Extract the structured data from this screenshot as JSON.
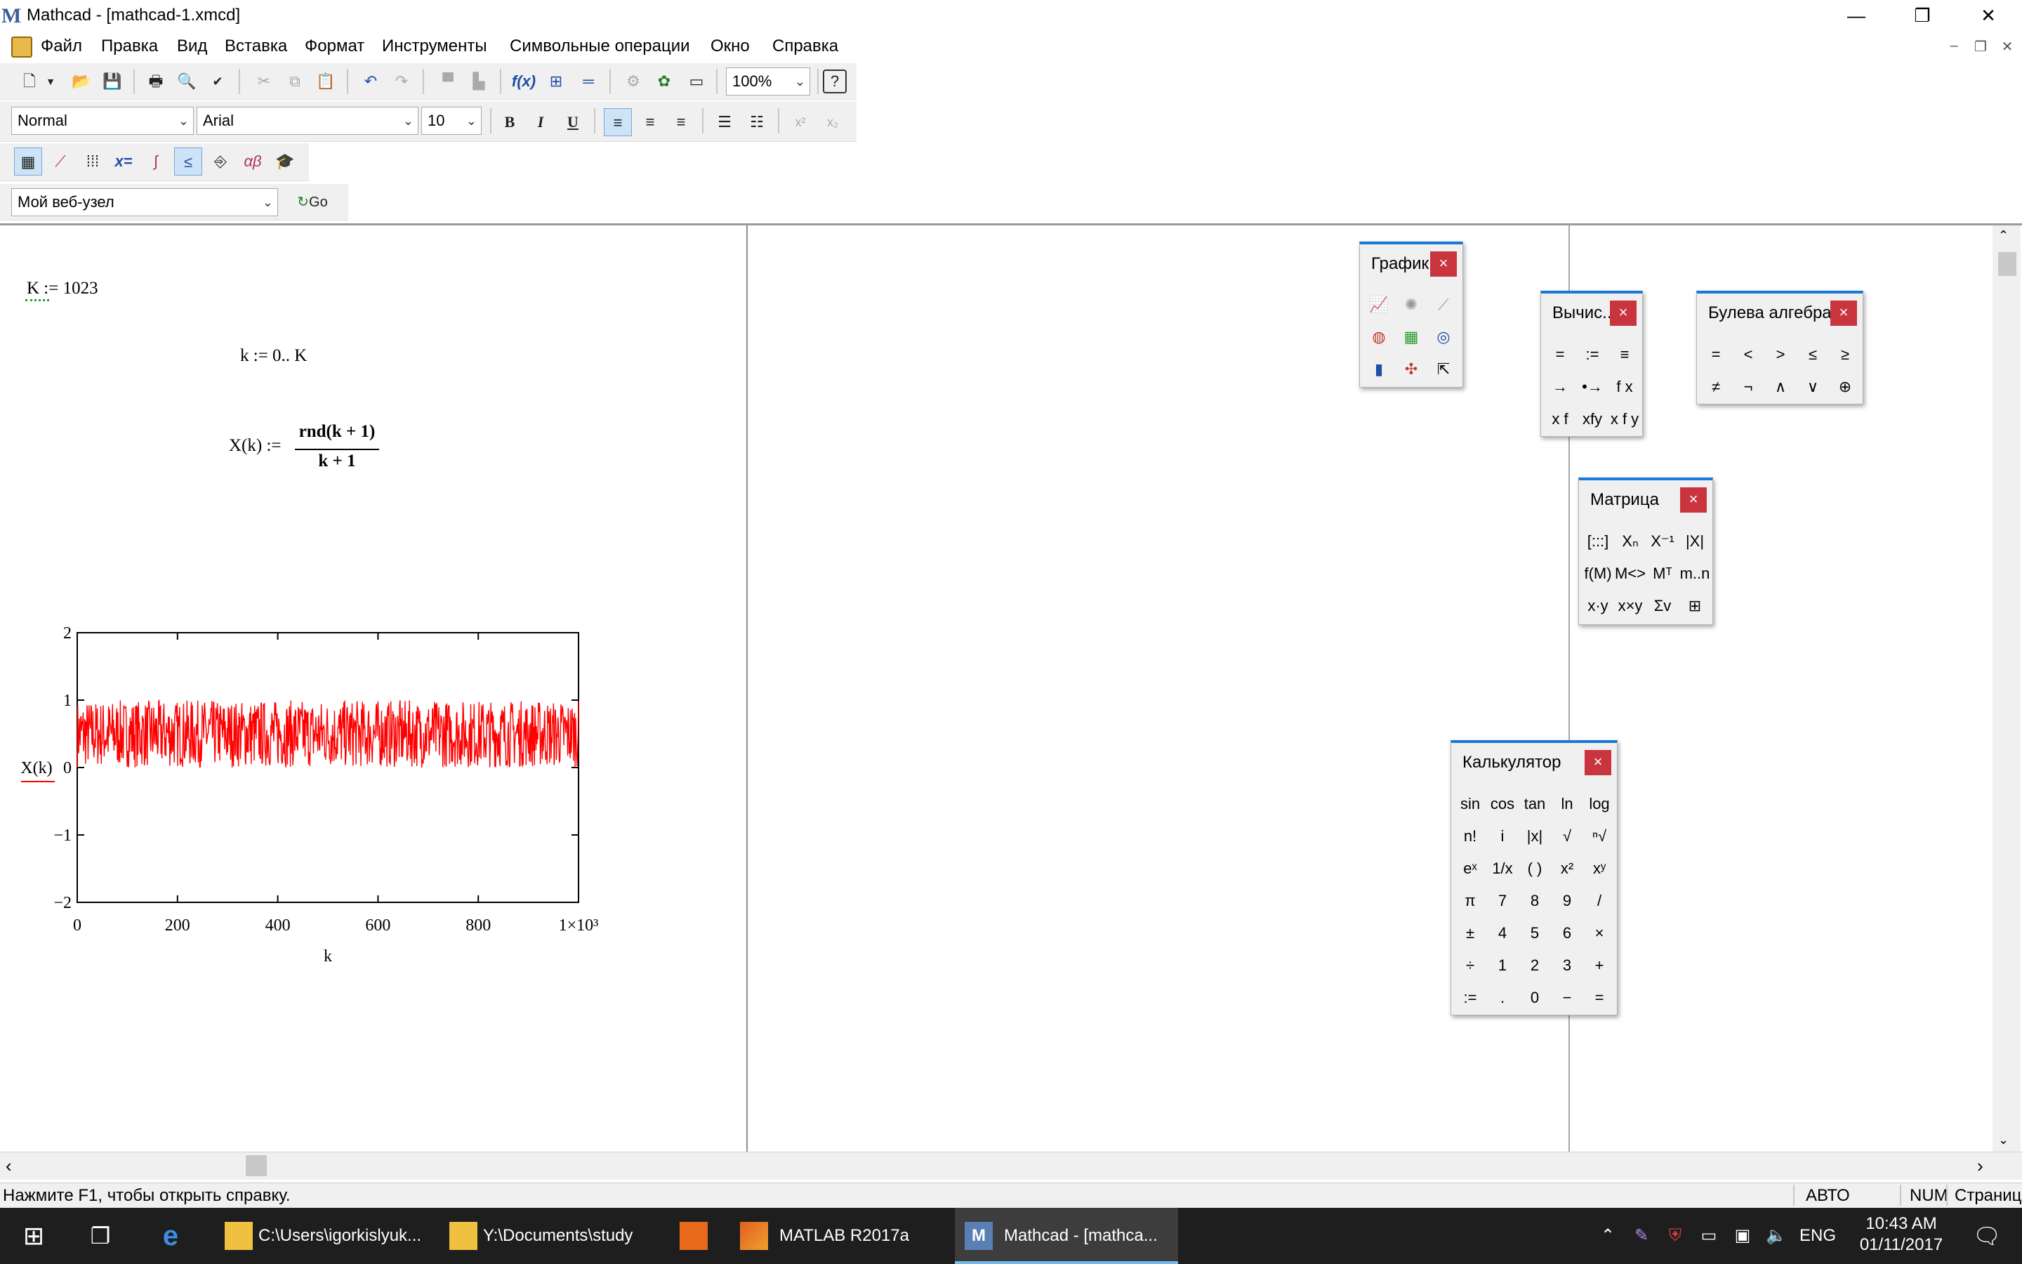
{
  "window": {
    "title": "Mathcad - [mathcad-1.xmcd]",
    "app_logo": "M",
    "controls": {
      "minimize": "—",
      "maximize": "❐",
      "close": "✕"
    }
  },
  "menu": {
    "items": [
      "Файл",
      "Правка",
      "Вид",
      "Вставка",
      "Формат",
      "Инструменты",
      "Символьные операции",
      "Окно",
      "Справка"
    ],
    "mdi_controls": [
      "–",
      "❐",
      "✕"
    ]
  },
  "toolbar_standard": {
    "zoom": "100%",
    "buttons": [
      "new-icon",
      "open-icon",
      "save-icon",
      "print-icon",
      "preview-icon",
      "spellcheck-icon",
      "cut-icon",
      "copy-icon",
      "paste-icon",
      "undo-icon",
      "redo-icon",
      "align-icon",
      "insert-function-icon",
      "insert-unit-icon",
      "calculate-icon",
      "resource-icon",
      "component-icon",
      "help-icon"
    ]
  },
  "toolbar_format": {
    "style": "Normal",
    "font": "Arial",
    "size": "10",
    "bold": "B",
    "italic": "I",
    "underline": "U"
  },
  "toolbar_math": {
    "buttons": [
      "calculator-icon",
      "graph-icon",
      "matrix-icon",
      "evaluation-icon",
      "calculus-icon",
      "boolean-icon",
      "programming-icon",
      "greek-icon",
      "symbolic-icon"
    ]
  },
  "toolbar_web": {
    "address": "Мой веб-узел",
    "go": "Go"
  },
  "worksheet": {
    "k_def": "K := 1023",
    "range_def": "k := 0.. K",
    "fn_lhs": "X(k) :=",
    "fn_num": "rnd(k + 1)",
    "fn_den": "k + 1"
  },
  "chart_data": {
    "type": "line",
    "xlabel": "k",
    "ylabel": "X(k)",
    "xlim": [
      0,
      1000
    ],
    "ylim": [
      -2,
      2
    ],
    "x_ticks": [
      "0",
      "200",
      "400",
      "600",
      "800",
      "1×10³"
    ],
    "y_ticks": [
      "2",
      "1",
      "0",
      "−1",
      "−2"
    ],
    "series": [
      {
        "color": "#ff0000",
        "x_range": [
          0,
          1023
        ],
        "y_band": [
          0.0,
          1.0
        ]
      }
    ]
  },
  "palettes": {
    "graph": {
      "title": "График",
      "close": "×"
    },
    "evaluation": {
      "title": "Вычис...",
      "close": "×",
      "cells": [
        "=",
        ":=",
        "≡",
        "→",
        "•→",
        "f x",
        "x f",
        "xfy",
        "x f y"
      ]
    },
    "boolean": {
      "title": "Булева алгебра",
      "close": "×",
      "cells": [
        "=",
        "<",
        ">",
        "≤",
        "≥",
        "≠",
        "¬",
        "∧",
        "∨",
        "⊕"
      ]
    },
    "matrix": {
      "title": "Матрица",
      "close": "×",
      "cells": [
        "[:::]",
        "Xₙ",
        "X⁻¹",
        "|X|",
        "f(M)",
        "M<>",
        "Mᵀ",
        "m..n",
        "x·y",
        "x×y",
        "Σv",
        "⊞"
      ]
    },
    "calculator": {
      "title": "Калькулятор",
      "close": "×",
      "cells": [
        "sin",
        "cos",
        "tan",
        "ln",
        "log",
        "n!",
        "i",
        "|x|",
        "√",
        "ⁿ√",
        "eˣ",
        "1/x",
        "( )",
        "x²",
        "xʸ",
        "π",
        "7",
        "8",
        "9",
        "/",
        "±",
        "4",
        "5",
        "6",
        "×",
        "÷",
        "1",
        "2",
        "3",
        "+",
        ":=",
        ".",
        "0",
        "−",
        "="
      ]
    }
  },
  "status": {
    "hint": "Нажмите F1, чтобы открыть справку.",
    "auto": "АВТО",
    "num": "NUM",
    "page": "Страниц"
  },
  "taskbar": {
    "items": [
      {
        "label": "C:\\Users\\igorkislyuk...",
        "icon": "folder-icon"
      },
      {
        "label": "Y:\\Documents\\study",
        "icon": "folder-icon"
      },
      {
        "label": "",
        "icon": "pdf-icon"
      },
      {
        "label": "MATLAB R2017a",
        "icon": "matlab-icon"
      },
      {
        "label": "Mathcad - [mathca...",
        "icon": "mathcad-icon"
      }
    ],
    "lang": "ENG",
    "time": "10:43 AM",
    "date": "01/11/2017"
  }
}
